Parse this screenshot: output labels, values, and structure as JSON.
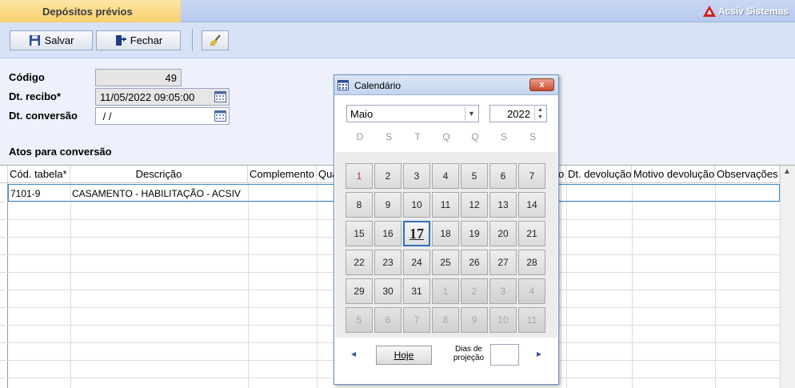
{
  "window": {
    "title": "Depósitos prévios",
    "brand": "Acsiv Sistemas"
  },
  "toolbar": {
    "save_label": "Salvar",
    "close_label": "Fechar"
  },
  "form": {
    "codigo_label": "Código",
    "codigo_value": "49",
    "recibo_label": "Dt. recibo*",
    "recibo_value": "11/05/2022 09:05:00",
    "conversao_label": "Dt. conversão",
    "conversao_value": " / /"
  },
  "atos": {
    "section_label": "Atos para conversão",
    "columns": [
      "Cód. tabela*",
      "Descrição",
      "Complemento",
      "Qua",
      "o",
      "Dt. devolução",
      "Motivo devolução",
      "Observações"
    ],
    "rows": [
      {
        "cod": "7101-9",
        "descricao": "CASAMENTO - HABILITAÇÃO - ACSIV"
      }
    ]
  },
  "calendar": {
    "title": "Calendário",
    "close_label": "x",
    "month": "Maio",
    "year": "2022",
    "weekdays": [
      "D",
      "S",
      "T",
      "Q",
      "Q",
      "S",
      "S"
    ],
    "weeks": [
      [
        "1",
        "2",
        "3",
        "4",
        "5",
        "6",
        "7"
      ],
      [
        "8",
        "9",
        "10",
        "11",
        "12",
        "13",
        "14"
      ],
      [
        "15",
        "16",
        "17",
        "18",
        "19",
        "20",
        "21"
      ],
      [
        "22",
        "23",
        "24",
        "25",
        "26",
        "27",
        "28"
      ],
      [
        "29",
        "30",
        "31",
        "1",
        "2",
        "3",
        "4"
      ],
      [
        "5",
        "6",
        "7",
        "8",
        "9",
        "10",
        "11"
      ]
    ],
    "selected_day": "17",
    "holiday_day": "1",
    "today_label": "Hoje",
    "dias_label_line1": "Dias de",
    "dias_label_line2": "projeção",
    "dias_value": ""
  },
  "colors": {
    "accent": "#2f6fbd",
    "title_tab": "#f7cf6d",
    "header": "#c9d8f3",
    "holiday": "#d12a2a"
  }
}
